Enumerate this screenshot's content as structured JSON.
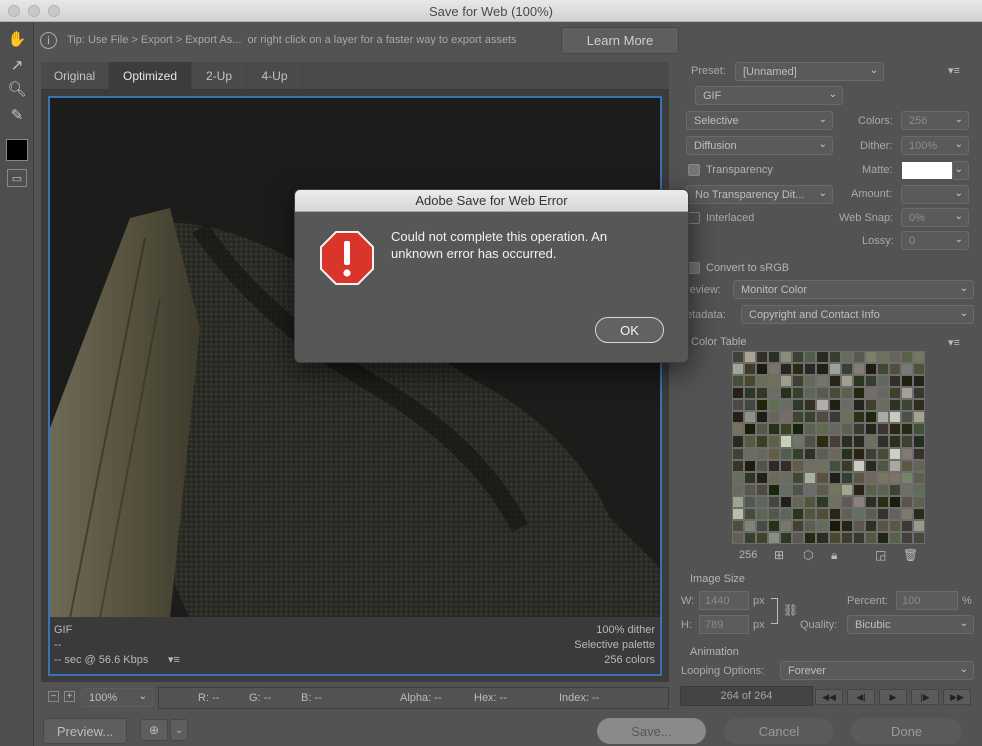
{
  "window": {
    "title": "Save for Web (100%)"
  },
  "tip": {
    "text": "Tip: Use File > Export > Export As...  or right click on a layer for a faster way to export assets",
    "button": "Learn More"
  },
  "tabs": [
    "Original",
    "Optimized",
    "2-Up",
    "4-Up"
  ],
  "preview_info": {
    "format": "GIF",
    "size": "--",
    "time": "-- sec @ 56.6 Kbps",
    "dither": "100% dither",
    "palette": "Selective palette",
    "colors": "256 colors"
  },
  "statusbar": {
    "zoom": "100%",
    "r": "R: --",
    "g": "G: --",
    "b": "B: --",
    "alpha": "Alpha: --",
    "hex": "Hex: --",
    "index": "Index: --"
  },
  "settings": {
    "preset_label": "Preset:",
    "preset_value": "[Unnamed]",
    "format": "GIF",
    "reduction": "Selective",
    "colors_label": "Colors:",
    "colors_value": "256",
    "dither_algo": "Diffusion",
    "dither_label": "Dither:",
    "dither_value": "100%",
    "transparency_label": "Transparency",
    "matte_label": "Matte:",
    "transparency_dither": "No Transparency Dit...",
    "amount_label": "Amount:",
    "interlaced_label": "Interlaced",
    "websnap_label": "Web Snap:",
    "websnap_value": "0%",
    "lossy_label": "Lossy:",
    "lossy_value": "0",
    "convert_label": "Convert to sRGB",
    "preview_label": "review:",
    "preview_value": "Monitor Color",
    "metadata_label": "etadata:",
    "metadata_value": "Copyright and Contact Info",
    "color_table_label": "Color Table",
    "color_count": "256"
  },
  "image_size": {
    "label": "Image Size",
    "w_label": "W:",
    "w_value": "1440",
    "h_label": "H:",
    "h_value": "789",
    "unit": "px",
    "percent_label": "Percent:",
    "percent_value": "100",
    "percent_unit": "%",
    "quality_label": "Quality:",
    "quality_value": "Bicubic"
  },
  "animation": {
    "label": "Animation",
    "looping_label": "Looping Options:",
    "looping_value": "Forever",
    "frame_counter": "264 of 264"
  },
  "bottom": {
    "preview": "Preview...",
    "save": "Save...",
    "cancel": "Cancel",
    "done": "Done"
  },
  "dialog": {
    "title": "Adobe Save for Web Error",
    "message": "Could not complete this operation. An unknown error has occurred.",
    "ok": "OK"
  },
  "colors": {
    "accent_frame": "#3a73b5",
    "error_red": "#d9352a"
  }
}
